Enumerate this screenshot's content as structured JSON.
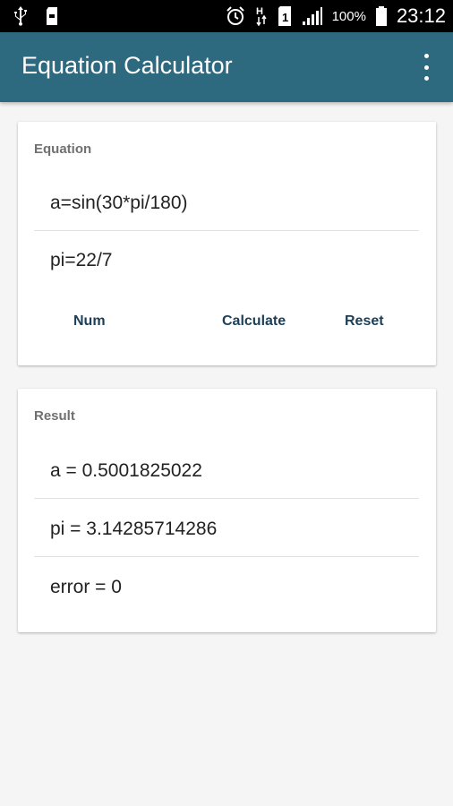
{
  "status_bar": {
    "battery_percent": "100%",
    "time": "23:12",
    "sim_slot": "1",
    "network_type": "H",
    "icons": [
      "usb-icon",
      "sd-card-icon",
      "alarm-icon",
      "data-arrows-icon",
      "sim-icon",
      "signal-icon",
      "battery-icon"
    ]
  },
  "app_bar": {
    "title": "Equation Calculator",
    "overflow_icon": "more-vert-icon",
    "color": "#2d6a7f"
  },
  "equation_card": {
    "header": "Equation",
    "lines": [
      "a=sin(30*pi/180)",
      "pi=22/7"
    ],
    "buttons": {
      "num": "Num",
      "calculate": "Calculate",
      "reset": "Reset"
    },
    "button_color": "#1c3f57"
  },
  "result_card": {
    "header": "Result",
    "lines": [
      "a = 0.5001825022",
      "pi = 3.14285714286",
      "error = 0"
    ]
  }
}
